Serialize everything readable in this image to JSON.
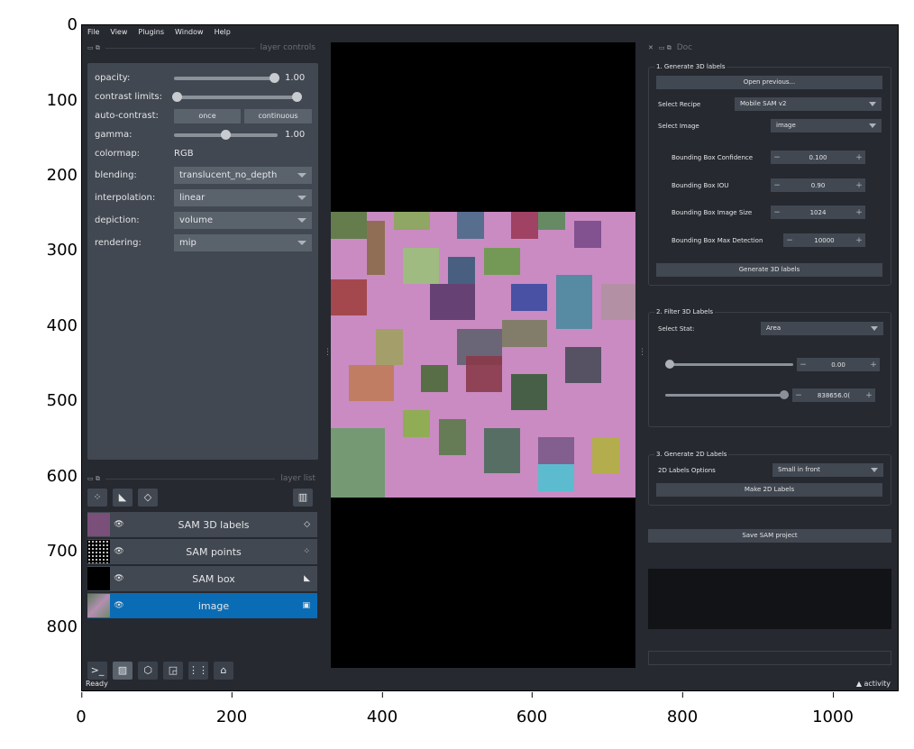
{
  "axes": {
    "y_ticks": [
      "0",
      "100",
      "200",
      "300",
      "400",
      "500",
      "600",
      "700",
      "800"
    ],
    "x_ticks": [
      "0",
      "200",
      "400",
      "600",
      "800",
      "1000"
    ]
  },
  "menu": [
    "File",
    "View",
    "Plugins",
    "Window",
    "Help"
  ],
  "layer_controls": {
    "title": "layer controls",
    "opacity_label": "opacity:",
    "opacity_value": "1.00",
    "contrast_label": "contrast limits:",
    "auto_contrast_label": "auto-contrast:",
    "once_label": "once",
    "continuous_label": "continuous",
    "gamma_label": "gamma:",
    "gamma_value": "1.00",
    "colormap_label": "colormap:",
    "colormap_value": "RGB",
    "blending_label": "blending:",
    "blending_value": "translucent_no_depth",
    "interpolation_label": "interpolation:",
    "interpolation_value": "linear",
    "depiction_label": "depiction:",
    "depiction_value": "volume",
    "rendering_label": "rendering:",
    "rendering_value": "mip"
  },
  "layer_list": {
    "title": "layer list",
    "layers": [
      {
        "name": "SAM 3D labels",
        "color": "#7a4f7a"
      },
      {
        "name": "SAM points",
        "color": "#000000"
      },
      {
        "name": "SAM box",
        "color": "#000000"
      },
      {
        "name": "image",
        "color": "#5c7a5c"
      }
    ]
  },
  "icons": {
    "eye": "👁",
    "console": ">_",
    "home": "⌂",
    "trash": "🗑"
  },
  "status": {
    "ready": "Ready",
    "activity": "▲ activity"
  },
  "doc": {
    "title": "Doc",
    "group1": {
      "title": "1. Generate 3D labels",
      "open_previous": "Open previous...",
      "recipe_label": "Select Recipe",
      "recipe_value": "Mobile SAM v2",
      "image_label": "Select Image",
      "image_value": "image",
      "confidence_label": "Bounding Box Confidence",
      "confidence_value": "0.100",
      "iou_label": "Bounding Box IOU",
      "iou_value": "0.90",
      "image_size_label": "Bounding Box Image Size",
      "image_size_value": "1024",
      "max_detection_label": "Bounding Box Max Detection",
      "max_detection_value": "10000",
      "generate_button": "Generate 3D labels"
    },
    "group2": {
      "title": "2. Filter 3D Labels",
      "stat_label": "Select Stat:",
      "stat_value": "Area",
      "min_value": "0.00",
      "max_value": "838656.0("
    },
    "group3": {
      "title": "3. Generate 2D Labels",
      "options_label": "2D Labels Options",
      "options_value": "Small in front",
      "make_button": "Make 2D Labels"
    },
    "save_button": "Save SAM project"
  }
}
